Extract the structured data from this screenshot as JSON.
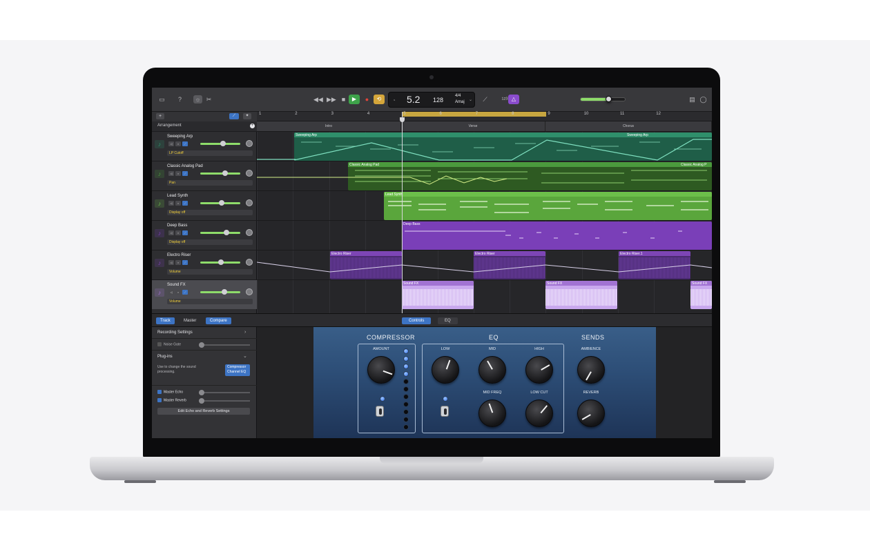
{
  "toolbar": {
    "bar_position": "5.2",
    "tempo": "128",
    "time_signature": "4/4",
    "key": "Amaj",
    "master_volume": 0.62,
    "icons": [
      "library-icon",
      "help-icon",
      "smart-controls-icon",
      "scissors-icon",
      "rewind-icon",
      "fast-forward-icon",
      "stop-icon",
      "play-icon",
      "record-icon",
      "cycle-icon",
      "tuner-icon",
      "count-in-icon",
      "metronome-icon",
      "notepad-icon",
      "loop-browser-icon"
    ]
  },
  "tracks_header": {
    "add_label": "+",
    "arrangement_label": "Arrangement"
  },
  "ruler": {
    "bars": [
      "1",
      "2",
      "3",
      "4",
      "5",
      "6",
      "7",
      "8",
      "9",
      "10",
      "11",
      "12"
    ]
  },
  "sections": [
    {
      "label": "Intro"
    },
    {
      "label": "Verse"
    },
    {
      "label": "Chorus"
    }
  ],
  "tracks": [
    {
      "name": "Sweeping Arp",
      "automation": "LP Cutoff",
      "icon": "synth-keyboard-icon",
      "color": "#2f8f6b",
      "volume": 0.55
    },
    {
      "name": "Classic Analog Pad",
      "automation": "Pan",
      "icon": "synth-pad-icon",
      "color": "#4b9a3d",
      "volume": 0.62
    },
    {
      "name": "Lead Synth",
      "automation": "Display off",
      "icon": "lead-synth-icon",
      "color": "#6cbf4a",
      "volume": 0.52
    },
    {
      "name": "Deep Bass",
      "automation": "Display off",
      "icon": "bass-synth-icon",
      "color": "#7a3fb8",
      "volume": 0.65
    },
    {
      "name": "Electro Riser",
      "automation": "Volume",
      "icon": "riser-icon",
      "color": "#7d45b5",
      "volume": 0.5
    },
    {
      "name": "Sound FX",
      "automation": "Volume",
      "icon": "sound-fx-icon",
      "color": "#a273d3",
      "volume": 0.6
    }
  ],
  "regions": {
    "sweeping_arp": "Sweeping Arp",
    "analog_pad": "Classic Analog Pad",
    "analog_pad_2": "Classic Analog P",
    "lead_synth": "Lead Synth",
    "deep_bass": "Deep Bass",
    "electro_riser": "Electro Riser",
    "electro_riser_1": "Electro Riser.1",
    "sound_fx": "Sound FX"
  },
  "bottom_tabs": {
    "track": "Track",
    "master": "Master",
    "compare": "Compare",
    "controls": "Controls",
    "eq": "EQ"
  },
  "left_pane": {
    "recording_settings": "Recording Settings",
    "noise_gate": "Noise Gate",
    "plugins": "Plug-ins",
    "plugins_hint_1": "Use to change the sound",
    "plugins_hint_2": "processing.",
    "plugin_list": [
      "Compressor",
      "Channel EQ"
    ],
    "master_echo": "Master Echo",
    "master_reverb": "Master Reverb",
    "edit_button": "Edit Echo and Reverb Settings"
  },
  "plugin": {
    "compressor_title": "COMPRESSOR",
    "eq_title": "EQ",
    "sends_title": "SENDS",
    "amount": "AMOUNT",
    "low": "LOW",
    "mid": "MID",
    "high": "HIGH",
    "mid_freq": "MID FREQ",
    "low_cut": "LOW CUT",
    "ambience": "AMBIENCE",
    "reverb": "REVERB",
    "meter_leds_lit": 4,
    "meter_leds_total": 11
  }
}
